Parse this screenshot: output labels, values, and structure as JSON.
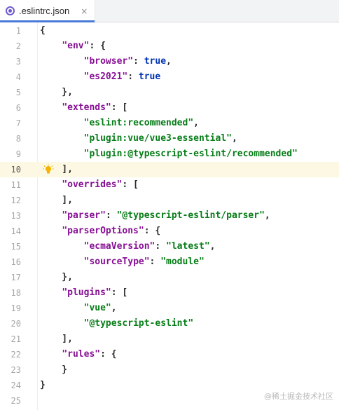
{
  "tab": {
    "label": ".eslintrc.json",
    "close": "×"
  },
  "watermark": "@稀土掘金技术社区",
  "lines": [
    {
      "n": "1",
      "tokens": [
        [
          "p",
          "{"
        ]
      ]
    },
    {
      "n": "2",
      "tokens": [
        [
          "p",
          "    "
        ],
        [
          "key",
          "\"env\""
        ],
        [
          "p",
          ": {"
        ]
      ]
    },
    {
      "n": "3",
      "tokens": [
        [
          "p",
          "        "
        ],
        [
          "key",
          "\"browser\""
        ],
        [
          "p",
          ": "
        ],
        [
          "kw",
          "true"
        ],
        [
          "p",
          ","
        ]
      ]
    },
    {
      "n": "4",
      "tokens": [
        [
          "p",
          "        "
        ],
        [
          "key",
          "\"es2021\""
        ],
        [
          "p",
          ": "
        ],
        [
          "kw",
          "true"
        ]
      ]
    },
    {
      "n": "5",
      "tokens": [
        [
          "p",
          "    },"
        ]
      ]
    },
    {
      "n": "6",
      "tokens": [
        [
          "p",
          "    "
        ],
        [
          "key",
          "\"extends\""
        ],
        [
          "p",
          ": ["
        ]
      ]
    },
    {
      "n": "7",
      "tokens": [
        [
          "p",
          "        "
        ],
        [
          "str",
          "\"eslint:recommended\""
        ],
        [
          "p",
          ","
        ]
      ]
    },
    {
      "n": "8",
      "tokens": [
        [
          "p",
          "        "
        ],
        [
          "str",
          "\"plugin:vue/vue3-essential\""
        ],
        [
          "p",
          ","
        ]
      ]
    },
    {
      "n": "9",
      "tokens": [
        [
          "p",
          "        "
        ],
        [
          "str",
          "\"plugin:@typescript-eslint/recommended\""
        ]
      ]
    },
    {
      "n": "10",
      "tokens": [
        [
          "p",
          "    ],"
        ]
      ],
      "current": true,
      "bulb": true
    },
    {
      "n": "11",
      "tokens": [
        [
          "p",
          "    "
        ],
        [
          "key",
          "\"overrides\""
        ],
        [
          "p",
          ": ["
        ]
      ]
    },
    {
      "n": "12",
      "tokens": [
        [
          "p",
          "    ],"
        ]
      ]
    },
    {
      "n": "13",
      "tokens": [
        [
          "p",
          "    "
        ],
        [
          "key",
          "\"parser\""
        ],
        [
          "p",
          ": "
        ],
        [
          "str",
          "\"@typescript-eslint/parser\""
        ],
        [
          "p",
          ","
        ]
      ]
    },
    {
      "n": "14",
      "tokens": [
        [
          "p",
          "    "
        ],
        [
          "key",
          "\"parserOptions\""
        ],
        [
          "p",
          ": {"
        ]
      ]
    },
    {
      "n": "15",
      "tokens": [
        [
          "p",
          "        "
        ],
        [
          "key",
          "\"ecmaVersion\""
        ],
        [
          "p",
          ": "
        ],
        [
          "str",
          "\"latest\""
        ],
        [
          "p",
          ","
        ]
      ]
    },
    {
      "n": "16",
      "tokens": [
        [
          "p",
          "        "
        ],
        [
          "key",
          "\"sourceType\""
        ],
        [
          "p",
          ": "
        ],
        [
          "str",
          "\"module\""
        ]
      ]
    },
    {
      "n": "17",
      "tokens": [
        [
          "p",
          "    },"
        ]
      ]
    },
    {
      "n": "18",
      "tokens": [
        [
          "p",
          "    "
        ],
        [
          "key",
          "\"plugins\""
        ],
        [
          "p",
          ": ["
        ]
      ]
    },
    {
      "n": "19",
      "tokens": [
        [
          "p",
          "        "
        ],
        [
          "str",
          "\"vue\""
        ],
        [
          "p",
          ","
        ]
      ]
    },
    {
      "n": "20",
      "tokens": [
        [
          "p",
          "        "
        ],
        [
          "str",
          "\"@typescript-eslint\""
        ]
      ]
    },
    {
      "n": "21",
      "tokens": [
        [
          "p",
          "    ],"
        ]
      ]
    },
    {
      "n": "22",
      "tokens": [
        [
          "p",
          "    "
        ],
        [
          "key",
          "\"rules\""
        ],
        [
          "p",
          ": {"
        ]
      ]
    },
    {
      "n": "23",
      "tokens": [
        [
          "p",
          "    }"
        ]
      ]
    },
    {
      "n": "24",
      "tokens": [
        [
          "p",
          "}"
        ]
      ]
    },
    {
      "n": "25",
      "tokens": []
    }
  ]
}
